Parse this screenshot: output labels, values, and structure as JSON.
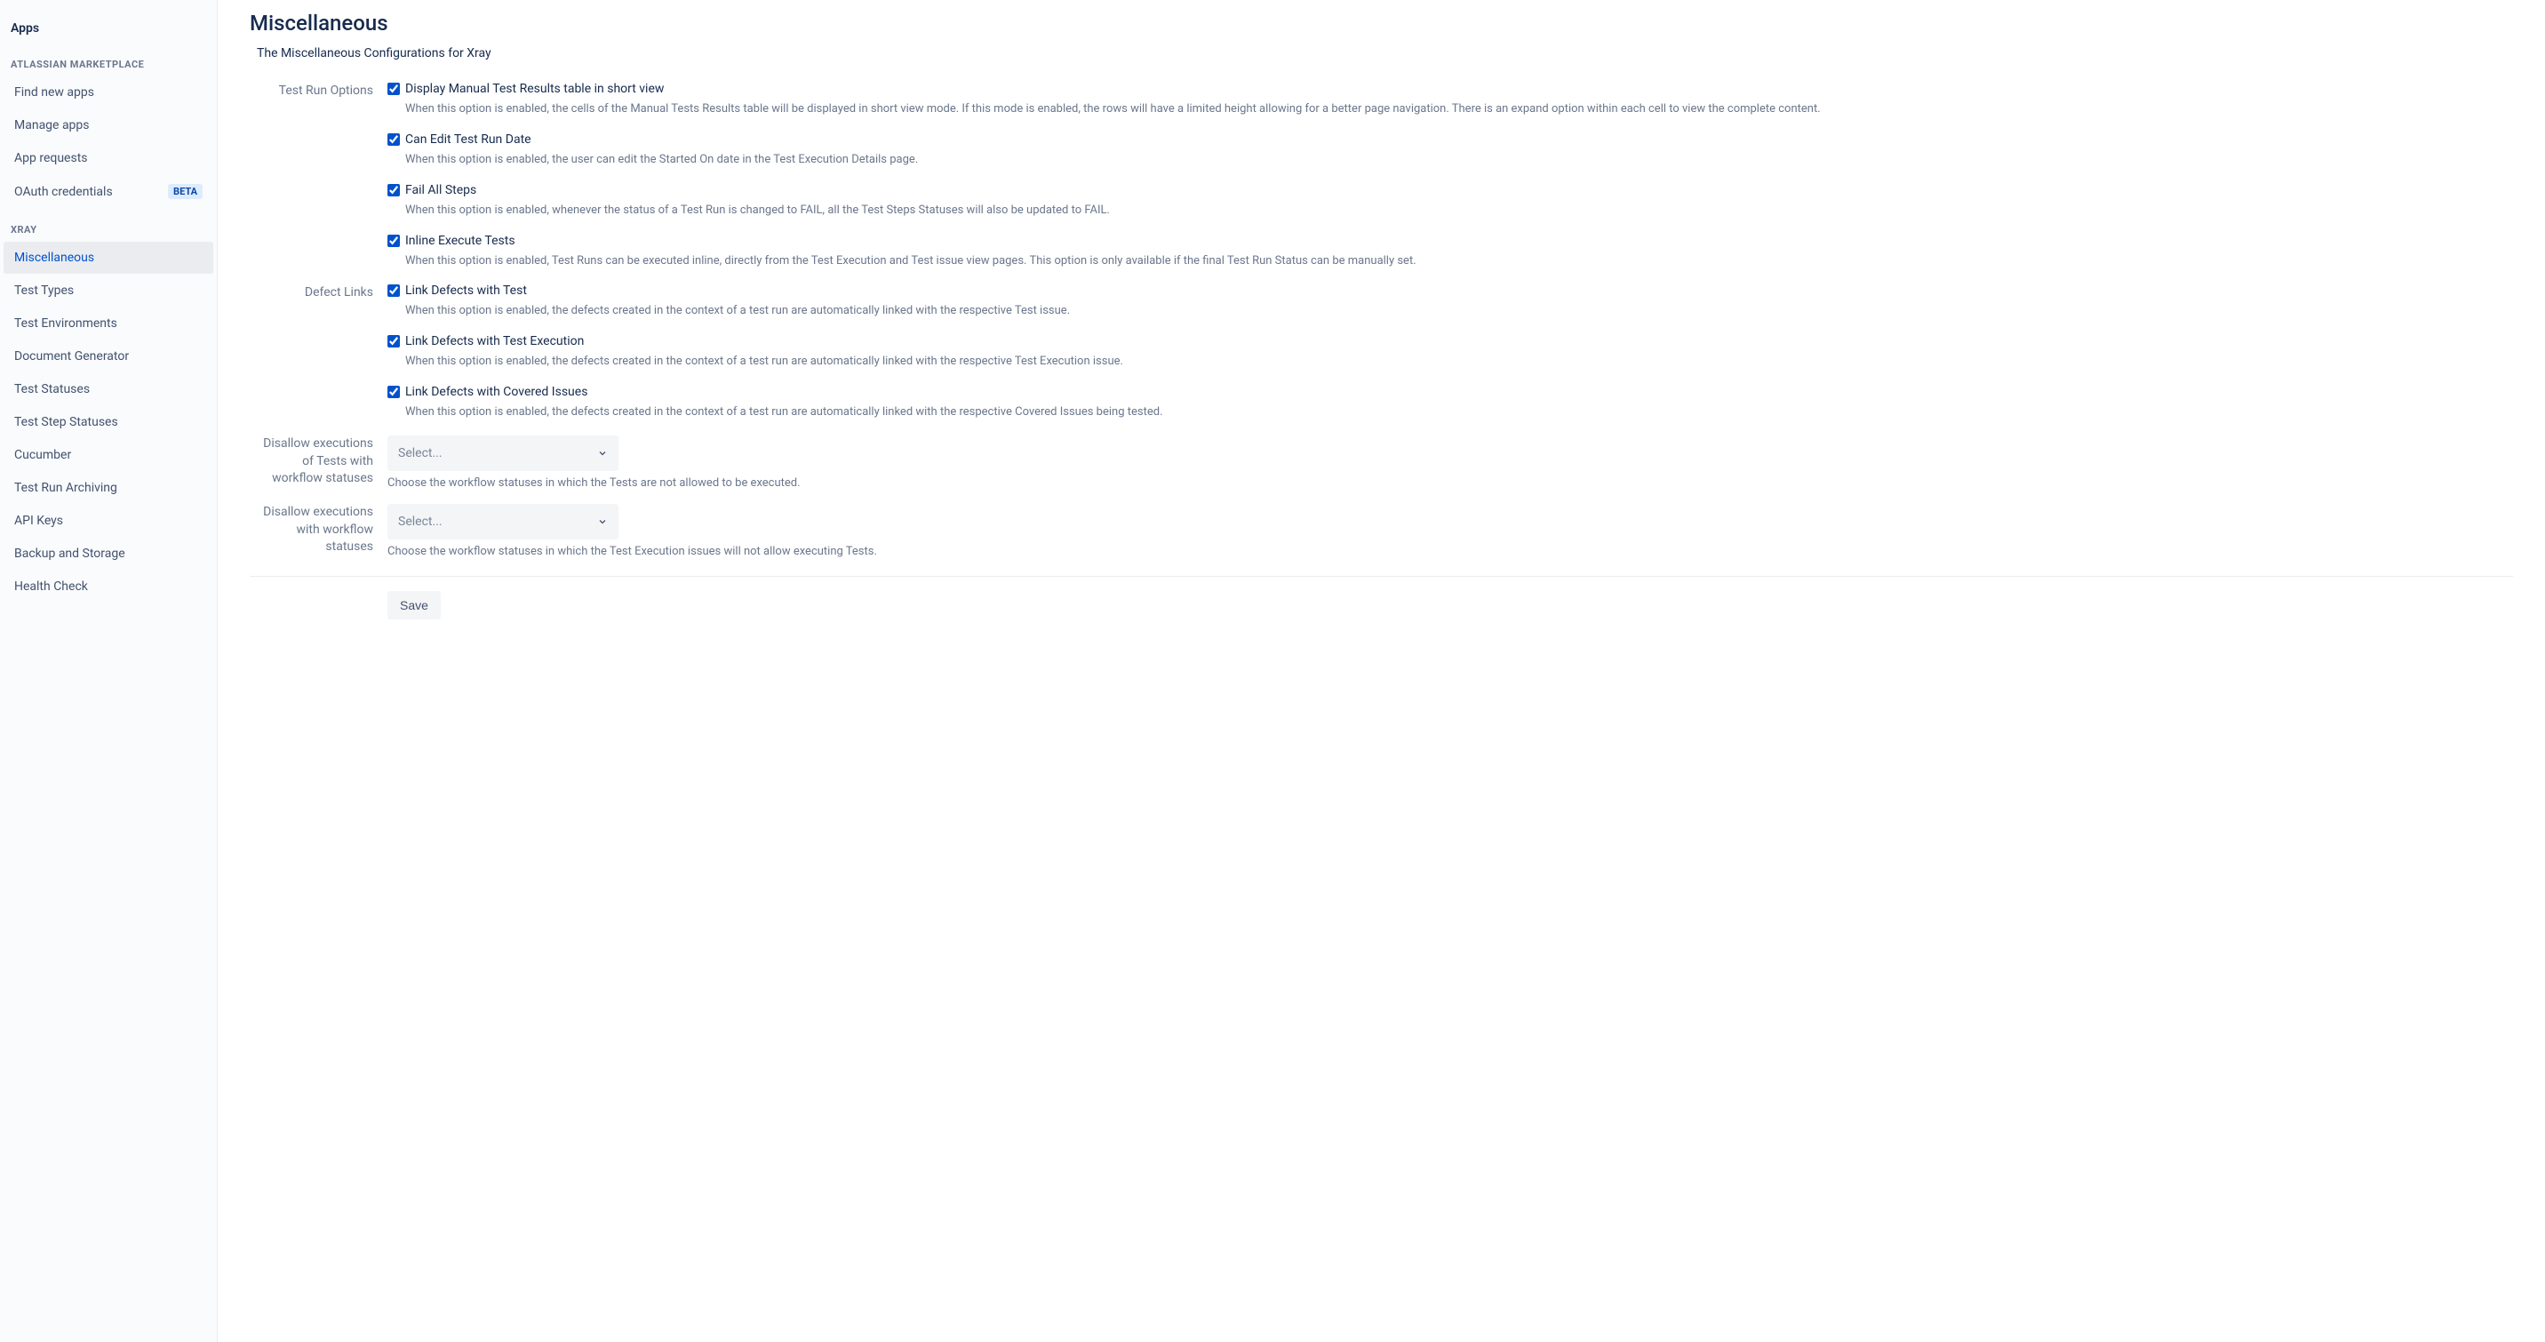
{
  "sidebar": {
    "heading": "Apps",
    "sections": [
      {
        "title": "ATLASSIAN MARKETPLACE",
        "items": [
          {
            "label": "Find new apps",
            "active": false,
            "badge": null
          },
          {
            "label": "Manage apps",
            "active": false,
            "badge": null
          },
          {
            "label": "App requests",
            "active": false,
            "badge": null
          },
          {
            "label": "OAuth credentials",
            "active": false,
            "badge": "BETA"
          }
        ]
      },
      {
        "title": "XRAY",
        "items": [
          {
            "label": "Miscellaneous",
            "active": true,
            "badge": null
          },
          {
            "label": "Test Types",
            "active": false,
            "badge": null
          },
          {
            "label": "Test Environments",
            "active": false,
            "badge": null
          },
          {
            "label": "Document Generator",
            "active": false,
            "badge": null
          },
          {
            "label": "Test Statuses",
            "active": false,
            "badge": null
          },
          {
            "label": "Test Step Statuses",
            "active": false,
            "badge": null
          },
          {
            "label": "Cucumber",
            "active": false,
            "badge": null
          },
          {
            "label": "Test Run Archiving",
            "active": false,
            "badge": null
          },
          {
            "label": "API Keys",
            "active": false,
            "badge": null
          },
          {
            "label": "Backup and Storage",
            "active": false,
            "badge": null
          },
          {
            "label": "Health Check",
            "active": false,
            "badge": null
          }
        ]
      }
    ]
  },
  "page": {
    "title": "Miscellaneous",
    "subtitle": "The Miscellaneous Configurations for Xray"
  },
  "groups": {
    "testRun": {
      "label": "Test Run Options",
      "options": [
        {
          "label": "Display Manual Test Results table in short view",
          "checked": true,
          "desc": "When this option is enabled, the cells of the Manual Tests Results table will be displayed in short view mode. If this mode is enabled, the rows will have a limited height allowing for a better page navigation. There is an expand option within each cell to view the complete content."
        },
        {
          "label": "Can Edit Test Run Date",
          "checked": true,
          "desc": "When this option is enabled, the user can edit the Started On date in the Test Execution Details page."
        },
        {
          "label": "Fail All Steps",
          "checked": true,
          "desc": "When this option is enabled, whenever the status of a Test Run is changed to FAIL, all the Test Steps Statuses will also be updated to FAIL."
        },
        {
          "label": "Inline Execute Tests",
          "checked": true,
          "desc": "When this option is enabled, Test Runs can be executed inline, directly from the Test Execution and Test issue view pages. This option is only available if the final Test Run Status can be manually set."
        }
      ]
    },
    "defectLinks": {
      "label": "Defect Links",
      "options": [
        {
          "label": "Link Defects with Test",
          "checked": true,
          "desc": "When this option is enabled, the defects created in the context of a test run are automatically linked with the respective Test issue."
        },
        {
          "label": "Link Defects with Test Execution",
          "checked": true,
          "desc": "When this option is enabled, the defects created in the context of a test run are automatically linked with the respective Test Execution issue."
        },
        {
          "label": "Link Defects with Covered Issues",
          "checked": true,
          "desc": "When this option is enabled, the defects created in the context of a test run are automatically linked with the respective Covered Issues being tested."
        }
      ]
    }
  },
  "selects": {
    "disallowTests": {
      "label": "Disallow executions of Tests with workflow statuses",
      "placeholder": "Select...",
      "hint": "Choose the workflow statuses in which the Tests are not allowed to be executed."
    },
    "disallowExec": {
      "label": "Disallow executions with workflow statuses",
      "placeholder": "Select...",
      "hint": "Choose the workflow statuses in which the Test Execution issues will not allow executing Tests."
    }
  },
  "buttons": {
    "save": "Save"
  }
}
